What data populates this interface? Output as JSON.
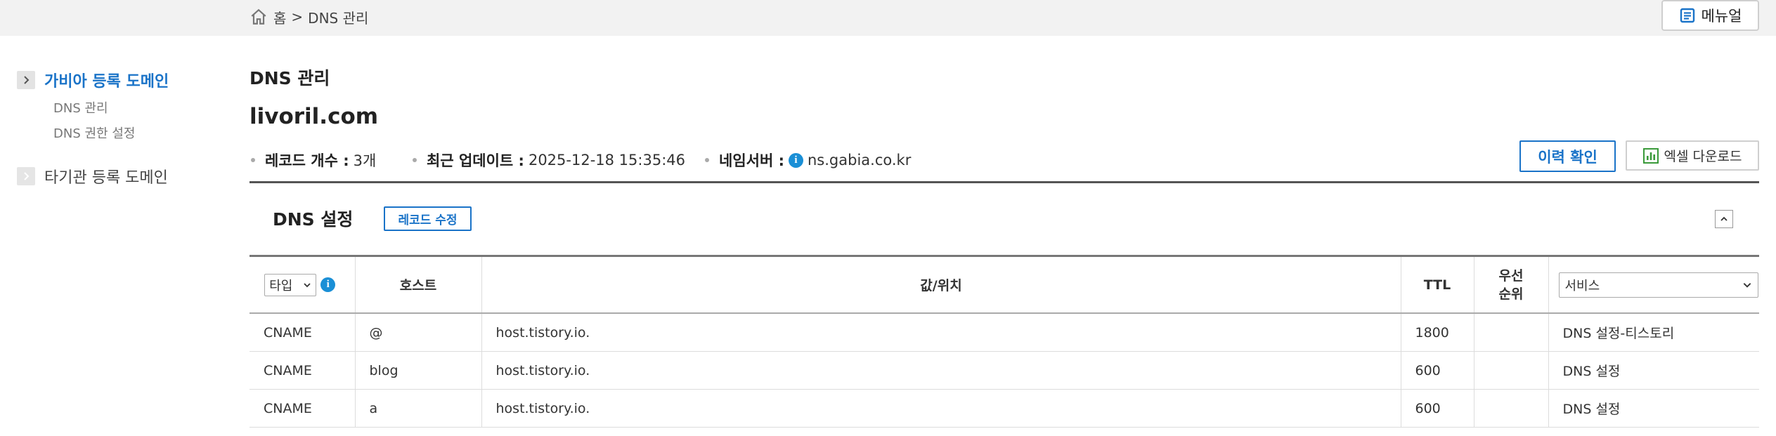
{
  "breadcrumb": {
    "home_label": "홈",
    "separator": ">",
    "current": "DNS 관리"
  },
  "manual_button": "메뉴얼",
  "sidebar": {
    "sections": [
      {
        "label": "가비아 등록 도메인",
        "active": true,
        "items": [
          "DNS 관리",
          "DNS 권한 설정"
        ]
      },
      {
        "label": "타기관 등록 도메인",
        "active": false,
        "items": []
      }
    ]
  },
  "page_title": "DNS 관리",
  "domain": "livoril.com",
  "meta": {
    "record_count_label": "레코드 개수 :",
    "record_count_value": "3개",
    "updated_label": "최근 업데이트 :",
    "updated_value": "2025-12-18 15:35:46",
    "nameserver_label": "네임서버 :",
    "nameserver_value": "ns.gabia.co.kr"
  },
  "buttons": {
    "history": "이력 확인",
    "excel": "엑셀 다운로드",
    "edit_records": "레코드 수정"
  },
  "dns_section_title": "DNS 설정",
  "table": {
    "type_select": "타입",
    "headers": {
      "host": "호스트",
      "value": "값/위치",
      "ttl": "TTL",
      "priority": "우선\n순위"
    },
    "service_select": "서비스",
    "rows": [
      {
        "type": "CNAME",
        "host": "@",
        "value": "host.tistory.io.",
        "ttl": "1800",
        "priority": "",
        "service": "DNS 설정-티스토리"
      },
      {
        "type": "CNAME",
        "host": "blog",
        "value": "host.tistory.io.",
        "ttl": "600",
        "priority": "",
        "service": "DNS 설정"
      },
      {
        "type": "CNAME",
        "host": "a",
        "value": "host.tistory.io.",
        "ttl": "600",
        "priority": "",
        "service": "DNS 설정"
      }
    ]
  },
  "colors": {
    "accent": "#1a73c8",
    "info": "#1a8fd6",
    "excel_green": "#3a9a3a",
    "topbar": "#f2f2f2"
  }
}
